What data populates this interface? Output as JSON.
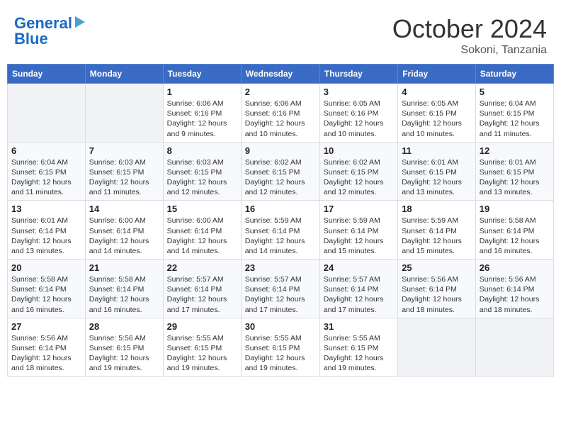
{
  "header": {
    "logo_line1": "General",
    "logo_line2": "Blue",
    "title": "October 2024",
    "subtitle": "Sokoni, Tanzania"
  },
  "calendar": {
    "weekdays": [
      "Sunday",
      "Monday",
      "Tuesday",
      "Wednesday",
      "Thursday",
      "Friday",
      "Saturday"
    ],
    "weeks": [
      [
        {
          "day": "",
          "info": ""
        },
        {
          "day": "",
          "info": ""
        },
        {
          "day": "1",
          "info": "Sunrise: 6:06 AM\nSunset: 6:16 PM\nDaylight: 12 hours and 9 minutes."
        },
        {
          "day": "2",
          "info": "Sunrise: 6:06 AM\nSunset: 6:16 PM\nDaylight: 12 hours and 10 minutes."
        },
        {
          "day": "3",
          "info": "Sunrise: 6:05 AM\nSunset: 6:16 PM\nDaylight: 12 hours and 10 minutes."
        },
        {
          "day": "4",
          "info": "Sunrise: 6:05 AM\nSunset: 6:15 PM\nDaylight: 12 hours and 10 minutes."
        },
        {
          "day": "5",
          "info": "Sunrise: 6:04 AM\nSunset: 6:15 PM\nDaylight: 12 hours and 11 minutes."
        }
      ],
      [
        {
          "day": "6",
          "info": "Sunrise: 6:04 AM\nSunset: 6:15 PM\nDaylight: 12 hours and 11 minutes."
        },
        {
          "day": "7",
          "info": "Sunrise: 6:03 AM\nSunset: 6:15 PM\nDaylight: 12 hours and 11 minutes."
        },
        {
          "day": "8",
          "info": "Sunrise: 6:03 AM\nSunset: 6:15 PM\nDaylight: 12 hours and 12 minutes."
        },
        {
          "day": "9",
          "info": "Sunrise: 6:02 AM\nSunset: 6:15 PM\nDaylight: 12 hours and 12 minutes."
        },
        {
          "day": "10",
          "info": "Sunrise: 6:02 AM\nSunset: 6:15 PM\nDaylight: 12 hours and 12 minutes."
        },
        {
          "day": "11",
          "info": "Sunrise: 6:01 AM\nSunset: 6:15 PM\nDaylight: 12 hours and 13 minutes."
        },
        {
          "day": "12",
          "info": "Sunrise: 6:01 AM\nSunset: 6:15 PM\nDaylight: 12 hours and 13 minutes."
        }
      ],
      [
        {
          "day": "13",
          "info": "Sunrise: 6:01 AM\nSunset: 6:14 PM\nDaylight: 12 hours and 13 minutes."
        },
        {
          "day": "14",
          "info": "Sunrise: 6:00 AM\nSunset: 6:14 PM\nDaylight: 12 hours and 14 minutes."
        },
        {
          "day": "15",
          "info": "Sunrise: 6:00 AM\nSunset: 6:14 PM\nDaylight: 12 hours and 14 minutes."
        },
        {
          "day": "16",
          "info": "Sunrise: 5:59 AM\nSunset: 6:14 PM\nDaylight: 12 hours and 14 minutes."
        },
        {
          "day": "17",
          "info": "Sunrise: 5:59 AM\nSunset: 6:14 PM\nDaylight: 12 hours and 15 minutes."
        },
        {
          "day": "18",
          "info": "Sunrise: 5:59 AM\nSunset: 6:14 PM\nDaylight: 12 hours and 15 minutes."
        },
        {
          "day": "19",
          "info": "Sunrise: 5:58 AM\nSunset: 6:14 PM\nDaylight: 12 hours and 16 minutes."
        }
      ],
      [
        {
          "day": "20",
          "info": "Sunrise: 5:58 AM\nSunset: 6:14 PM\nDaylight: 12 hours and 16 minutes."
        },
        {
          "day": "21",
          "info": "Sunrise: 5:58 AM\nSunset: 6:14 PM\nDaylight: 12 hours and 16 minutes."
        },
        {
          "day": "22",
          "info": "Sunrise: 5:57 AM\nSunset: 6:14 PM\nDaylight: 12 hours and 17 minutes."
        },
        {
          "day": "23",
          "info": "Sunrise: 5:57 AM\nSunset: 6:14 PM\nDaylight: 12 hours and 17 minutes."
        },
        {
          "day": "24",
          "info": "Sunrise: 5:57 AM\nSunset: 6:14 PM\nDaylight: 12 hours and 17 minutes."
        },
        {
          "day": "25",
          "info": "Sunrise: 5:56 AM\nSunset: 6:14 PM\nDaylight: 12 hours and 18 minutes."
        },
        {
          "day": "26",
          "info": "Sunrise: 5:56 AM\nSunset: 6:14 PM\nDaylight: 12 hours and 18 minutes."
        }
      ],
      [
        {
          "day": "27",
          "info": "Sunrise: 5:56 AM\nSunset: 6:14 PM\nDaylight: 12 hours and 18 minutes."
        },
        {
          "day": "28",
          "info": "Sunrise: 5:56 AM\nSunset: 6:15 PM\nDaylight: 12 hours and 19 minutes."
        },
        {
          "day": "29",
          "info": "Sunrise: 5:55 AM\nSunset: 6:15 PM\nDaylight: 12 hours and 19 minutes."
        },
        {
          "day": "30",
          "info": "Sunrise: 5:55 AM\nSunset: 6:15 PM\nDaylight: 12 hours and 19 minutes."
        },
        {
          "day": "31",
          "info": "Sunrise: 5:55 AM\nSunset: 6:15 PM\nDaylight: 12 hours and 19 minutes."
        },
        {
          "day": "",
          "info": ""
        },
        {
          "day": "",
          "info": ""
        }
      ]
    ]
  }
}
